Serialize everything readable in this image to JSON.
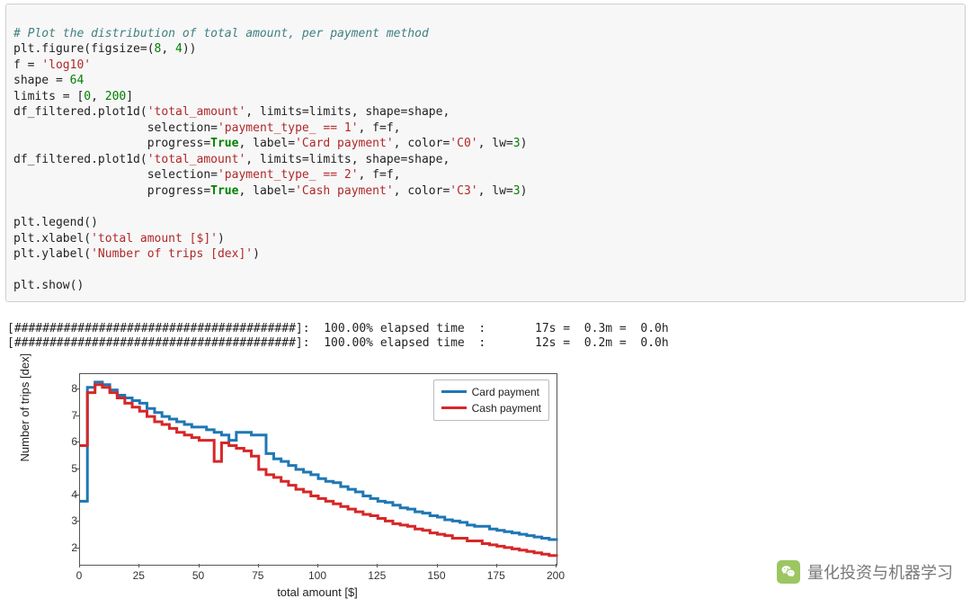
{
  "code": {
    "comment": "# Plot the distribution of total amount, per payment method",
    "l1a": "plt.figure(figsize=(",
    "l1b": "8",
    "l1c": ", ",
    "l1d": "4",
    "l1e": "))",
    "l2a": "f = ",
    "l2b": "'log10'",
    "l3a": "shape = ",
    "l3b": "64",
    "l4a": "limits = [",
    "l4b": "0",
    "l4c": ", ",
    "l4d": "200",
    "l4e": "]",
    "l5a": "df_filtered.plot1d(",
    "l5b": "'total_amount'",
    "l5c": ", limits=limits, shape=shape,",
    "l6a": "                   selection=",
    "l6b": "'payment_type_ == 1'",
    "l6c": ", f=f,",
    "l7a": "                   progress=",
    "l7b": "True",
    "l7c": ", label=",
    "l7d": "'Card payment'",
    "l7e": ", color=",
    "l7f": "'C0'",
    "l7g": ", lw=",
    "l7h": "3",
    "l7i": ")",
    "l8a": "df_filtered.plot1d(",
    "l8b": "'total_amount'",
    "l8c": ", limits=limits, shape=shape,",
    "l9a": "                   selection=",
    "l9b": "'payment_type_ == 2'",
    "l9c": ", f=f,",
    "l10a": "                   progress=",
    "l10b": "True",
    "l10c": ", label=",
    "l10d": "'Cash payment'",
    "l10e": ", color=",
    "l10f": "'C3'",
    "l10g": ", lw=",
    "l10h": "3",
    "l10i": ")",
    "blank": "",
    "l11": "plt.legend()",
    "l12a": "plt.xlabel(",
    "l12b": "'total amount [$]'",
    "l12c": ")",
    "l13a": "plt.ylabel(",
    "l13b": "'Number of trips [dex]'",
    "l13c": ")",
    "l14": "plt.show()"
  },
  "output": {
    "line1": "[########################################]:  100.00% elapsed time  :       17s =  0.3m =  0.0h",
    "line2": "[########################################]:  100.00% elapsed time  :       12s =  0.2m =  0.0h"
  },
  "chart_data": {
    "type": "line",
    "title": "",
    "xlabel": "total amount [$]",
    "ylabel": "Number of trips [dex]",
    "xlim": [
      0,
      200
    ],
    "ylim": [
      1.4,
      8.6
    ],
    "xticks": [
      0,
      25,
      50,
      75,
      100,
      125,
      150,
      175,
      200
    ],
    "yticks": [
      2,
      3,
      4,
      5,
      6,
      7,
      8
    ],
    "legend_position": "upper right",
    "series": [
      {
        "name": "Card payment",
        "color": "#1f77b4",
        "x": [
          0,
          3.1,
          6.3,
          9.4,
          12.5,
          15.6,
          18.8,
          21.9,
          25,
          28.1,
          31.3,
          34.4,
          37.5,
          40.6,
          43.8,
          46.9,
          50,
          53.1,
          56.3,
          59.4,
          62.5,
          65.6,
          68.8,
          71.9,
          75,
          78.1,
          81.3,
          84.4,
          87.5,
          90.6,
          93.8,
          96.9,
          100,
          103.1,
          106.3,
          109.4,
          112.5,
          115.6,
          118.8,
          121.9,
          125,
          128.1,
          131.3,
          134.4,
          137.5,
          140.6,
          143.8,
          146.9,
          150,
          153.1,
          156.3,
          159.4,
          162.5,
          165.6,
          168.8,
          171.9,
          175,
          178.1,
          181.3,
          184.4,
          187.5,
          190.6,
          193.8,
          196.9,
          200
        ],
        "values": [
          3.8,
          8.1,
          8.3,
          8.2,
          8.0,
          7.8,
          7.7,
          7.6,
          7.5,
          7.3,
          7.15,
          7.0,
          6.9,
          6.8,
          6.7,
          6.6,
          6.6,
          6.5,
          6.4,
          6.3,
          6.1,
          6.4,
          6.4,
          6.3,
          6.3,
          5.6,
          5.4,
          5.3,
          5.15,
          5.0,
          4.9,
          4.8,
          4.65,
          4.55,
          4.5,
          4.35,
          4.25,
          4.15,
          4.0,
          3.9,
          3.8,
          3.75,
          3.65,
          3.55,
          3.5,
          3.4,
          3.35,
          3.25,
          3.2,
          3.1,
          3.05,
          3.0,
          2.9,
          2.85,
          2.85,
          2.75,
          2.7,
          2.65,
          2.6,
          2.55,
          2.5,
          2.45,
          2.4,
          2.35,
          2.3
        ]
      },
      {
        "name": "Cash payment",
        "color": "#d62728",
        "x": [
          0,
          3.1,
          6.3,
          9.4,
          12.5,
          15.6,
          18.8,
          21.9,
          25,
          28.1,
          31.3,
          34.4,
          37.5,
          40.6,
          43.8,
          46.9,
          50,
          53.1,
          56.3,
          59.4,
          62.5,
          65.6,
          68.8,
          71.9,
          75,
          78.1,
          81.3,
          84.4,
          87.5,
          90.6,
          93.8,
          96.9,
          100,
          103.1,
          106.3,
          109.4,
          112.5,
          115.6,
          118.8,
          121.9,
          125,
          128.1,
          131.3,
          134.4,
          137.5,
          140.6,
          143.8,
          146.9,
          150,
          153.1,
          156.3,
          159.4,
          162.5,
          165.6,
          168.8,
          171.9,
          175,
          178.1,
          181.3,
          184.4,
          187.5,
          190.6,
          193.8,
          196.9,
          200
        ],
        "values": [
          5.9,
          7.9,
          8.2,
          8.1,
          7.9,
          7.7,
          7.5,
          7.35,
          7.2,
          7.0,
          6.8,
          6.7,
          6.55,
          6.4,
          6.3,
          6.2,
          6.1,
          6.1,
          5.3,
          6.0,
          5.9,
          5.8,
          5.7,
          5.5,
          5.0,
          4.8,
          4.7,
          4.55,
          4.4,
          4.25,
          4.15,
          4.0,
          3.9,
          3.8,
          3.7,
          3.6,
          3.5,
          3.4,
          3.3,
          3.25,
          3.15,
          3.05,
          2.95,
          2.9,
          2.85,
          2.75,
          2.7,
          2.6,
          2.55,
          2.5,
          2.4,
          2.4,
          2.3,
          2.3,
          2.2,
          2.15,
          2.1,
          2.05,
          2.0,
          1.95,
          1.9,
          1.85,
          1.8,
          1.75,
          1.7
        ]
      }
    ]
  },
  "legend": {
    "s1": "Card payment",
    "s2": "Cash payment"
  },
  "watermark": {
    "text": "量化投资与机器学习",
    "icon": "wechat-icon"
  }
}
